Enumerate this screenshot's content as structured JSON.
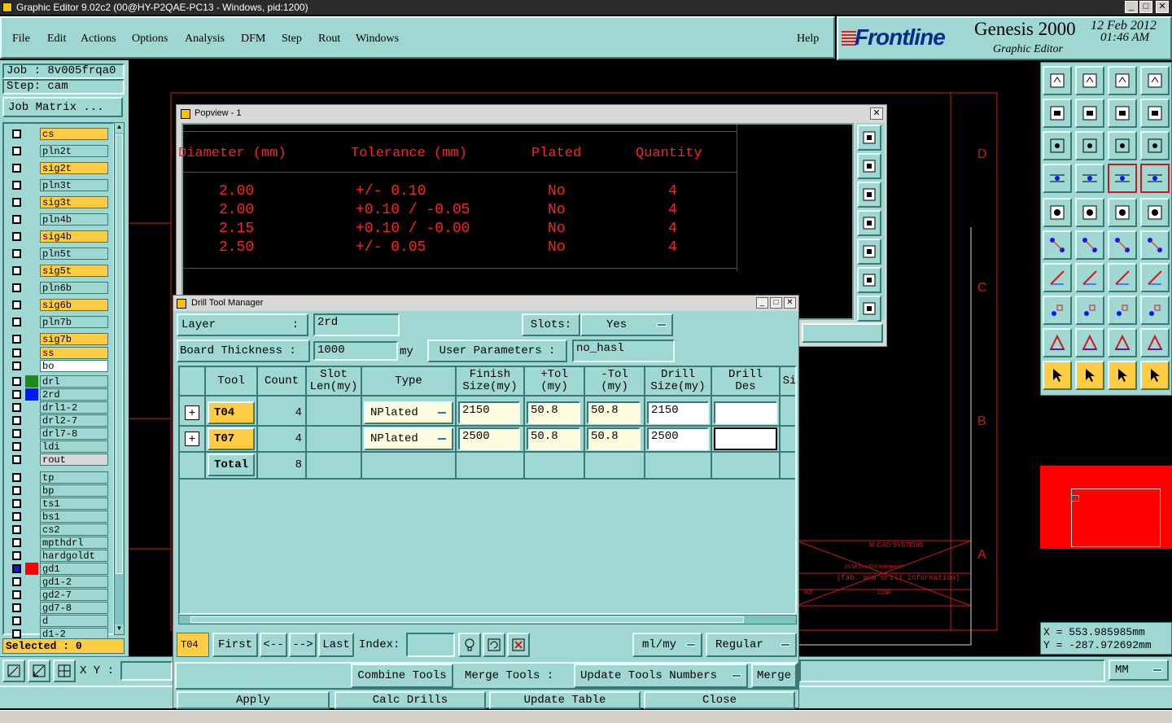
{
  "window_title": "Graphic Editor 9.02c2 (00@HY-P2QAE-PC13 - Windows, pid:1200)",
  "menu": [
    "File",
    "Edit",
    "Actions",
    "Options",
    "Analysis",
    "DFM",
    "Step",
    "Rout",
    "Windows"
  ],
  "help_label": "Help",
  "brand": {
    "logo": "Frontline",
    "product": "Genesis 2000",
    "subtitle": "Graphic Editor",
    "date": "12 Feb 2012",
    "time": "01:46 AM"
  },
  "job": {
    "job_label": "Job : 8v005frqa0",
    "step_label": "Step: cam",
    "matrix_button": "Job Matrix ..."
  },
  "layers": [
    {
      "name": "cs",
      "color": "#ffcc44"
    },
    {
      "name": "pln2t",
      "color": "#9fd8d2"
    },
    {
      "name": "sig2t",
      "color": "#ffcc44"
    },
    {
      "name": "pln3t",
      "color": "#9fd8d2"
    },
    {
      "name": "sig3t",
      "color": "#ffcc44"
    },
    {
      "name": "pln4b",
      "color": "#9fd8d2"
    },
    {
      "name": "sig4b",
      "color": "#ffcc44"
    },
    {
      "name": "pln5t",
      "color": "#9fd8d2"
    },
    {
      "name": "sig5t",
      "color": "#ffcc44"
    },
    {
      "name": "pln6b",
      "color": "#9fd8d2"
    },
    {
      "name": "sig6b",
      "color": "#ffcc44"
    },
    {
      "name": "pln7b",
      "color": "#9fd8d2"
    },
    {
      "name": "sig7b",
      "color": "#ffcc44"
    },
    {
      "name": "ss",
      "color": "#ffcc44"
    },
    {
      "name": "bo",
      "color": "#ffffff"
    },
    {
      "name": "drl",
      "color": "#9fd8d2",
      "swatch": "#1e8a1e"
    },
    {
      "name": "2rd",
      "color": "#9fd8d2",
      "swatch": "#0018ff"
    },
    {
      "name": "drl1-2",
      "color": "#9fd8d2"
    },
    {
      "name": "drl2-7",
      "color": "#9fd8d2"
    },
    {
      "name": "drl7-8",
      "color": "#9fd8d2"
    },
    {
      "name": "ldi",
      "color": "#9fd8d2"
    },
    {
      "name": "rout",
      "color": "#d8d8d8"
    },
    {
      "name": "tp",
      "color": "#9fd8d2"
    },
    {
      "name": "bp",
      "color": "#9fd8d2"
    },
    {
      "name": "ts1",
      "color": "#9fd8d2"
    },
    {
      "name": "bs1",
      "color": "#9fd8d2"
    },
    {
      "name": "cs2",
      "color": "#9fd8d2"
    },
    {
      "name": "mpthdrl",
      "color": "#9fd8d2"
    },
    {
      "name": "hardgoldt",
      "color": "#9fd8d2"
    },
    {
      "name": "gd1",
      "color": "#9fd8d2",
      "swatch": "#ff0000"
    },
    {
      "name": "gd1-2",
      "color": "#9fd8d2"
    },
    {
      "name": "gd2-7",
      "color": "#9fd8d2"
    },
    {
      "name": "gd7-8",
      "color": "#9fd8d2"
    },
    {
      "name": "d",
      "color": "#9fd8d2"
    },
    {
      "name": "d1-2",
      "color": "#9fd8d2"
    }
  ],
  "selected_label": "Selected : 0",
  "xy_label": "X Y :",
  "coords": {
    "x": "X  =  553.985985mm",
    "y": "Y  = -287.972692mm"
  },
  "units": "MM",
  "popview": {
    "title": "Popview - 1",
    "headers": [
      "Diameter (mm)",
      "Tolerance (mm)",
      "Plated",
      "Quantity"
    ],
    "rows": [
      [
        "2.00",
        "+/- 0.10",
        "No",
        "4"
      ],
      [
        "2.00",
        "+0.10 / -0.05",
        "No",
        "4"
      ],
      [
        "2.15",
        "+0.10 / -0.00",
        "No",
        "4"
      ],
      [
        "2.50",
        "+/- 0.05",
        "No",
        "4"
      ]
    ]
  },
  "dtm": {
    "title": "Drill Tool Manager",
    "layer_label": "Layer",
    "layer_colon": ":",
    "layer_value": "2rd",
    "slots_label": "Slots:",
    "slots_value": "Yes",
    "thickness_label": "Board Thickness :",
    "thickness_value": "1000",
    "thickness_unit": "my",
    "user_params_label": "User Parameters :",
    "user_params_value": "no_hasl",
    "columns": [
      "Tool",
      "Count",
      "Slot\nLen(my)",
      "Type",
      "Finish\nSize(my)",
      "+Tol\n(my)",
      "-Tol\n(my)",
      "Drill\nSize(my)",
      "Drill\nDes",
      "Si"
    ],
    "rows": [
      {
        "tool": "T04",
        "count": "4",
        "type": "NPlated",
        "finish": "2150",
        "ptol": "50.8",
        "mtol": "50.8",
        "drill": "2150"
      },
      {
        "tool": "T07",
        "count": "4",
        "type": "NPlated",
        "finish": "2500",
        "ptol": "50.8",
        "mtol": "50.8",
        "drill": "2500"
      }
    ],
    "total_label": "Total",
    "total_count": "8",
    "current_tool": "T04",
    "nav": {
      "first": "First",
      "prev": "<--",
      "next": "-->",
      "last": "Last",
      "index": "Index:"
    },
    "unit_select": "ml/my",
    "mode_select": "Regular",
    "combine": "Combine Tools",
    "merge_label": "Merge Tools :",
    "update_numbers": "Update Tools Numbers",
    "merge": "Merge",
    "apply": "Apply",
    "calc": "Calc Drills",
    "update_table": "Update Table",
    "close": "Close"
  },
  "drawing": {
    "border_letters": [
      "D",
      "C",
      "B",
      "A"
    ],
    "title_block": {
      "company": "M-CAD SYSTEMS",
      "line1": "c158 to c15h interposer",
      "line2": "(fab. and drill information)",
      "size": "A3",
      "code": "CDR"
    }
  }
}
